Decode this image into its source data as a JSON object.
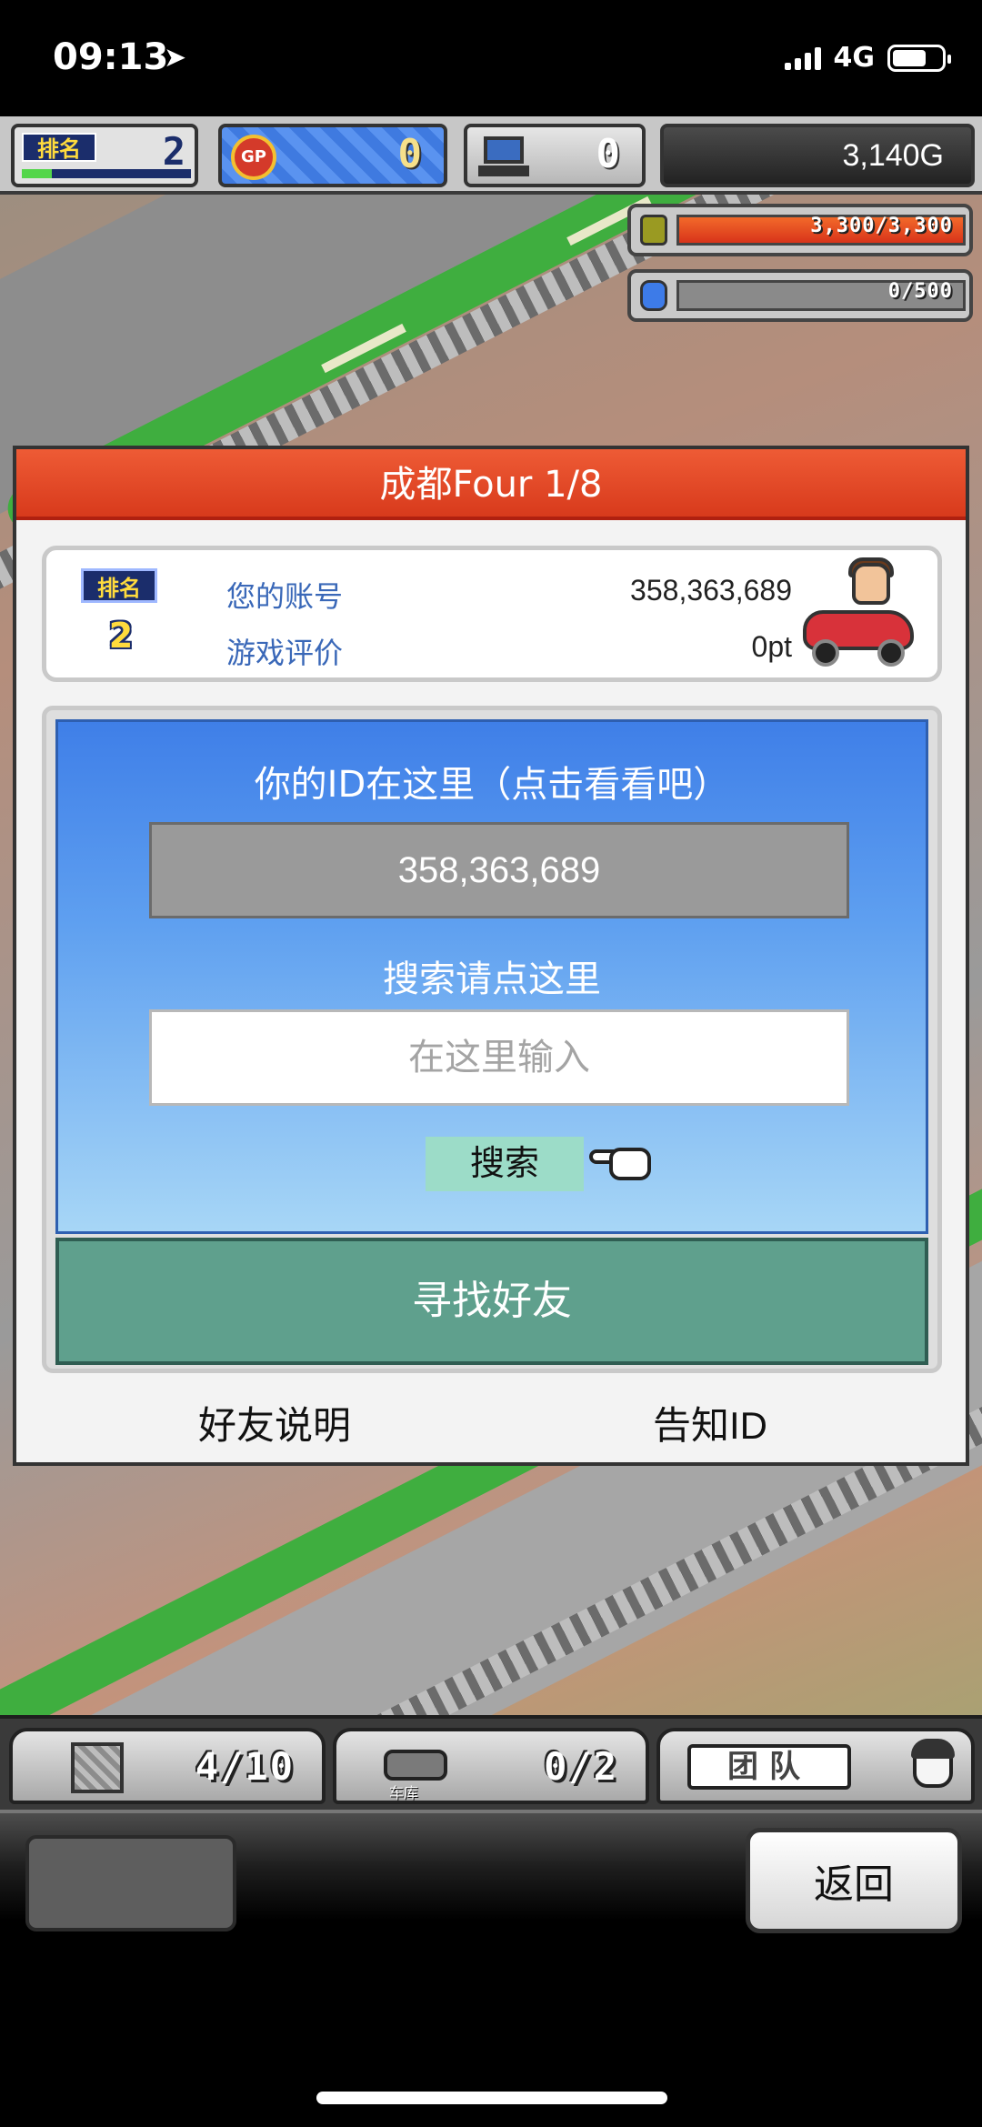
{
  "status": {
    "time": "09:13",
    "network": "4G"
  },
  "hud": {
    "rank_badge": "排名",
    "rank_value": "2",
    "gp_label": "GP",
    "gp_value": "0",
    "pc_value": "0",
    "money": "3,140G"
  },
  "resources": {
    "fuel": {
      "text": "3,300/3,300",
      "fill": 1.0
    },
    "parts": {
      "text": "0/500",
      "fill": 0.0
    }
  },
  "dialog": {
    "title": "成都Four 1/8",
    "profile": {
      "rank_badge": "排名",
      "rank_value": "2",
      "account_label": "您的账号",
      "account_value": "358,363,689",
      "rating_label": "游戏评价",
      "rating_value": "0pt"
    },
    "id_title": "你的ID在这里（点击看看吧）",
    "id_value": "358,363,689",
    "search_title": "搜索请点这里",
    "search_placeholder": "在这里输入",
    "search_button": "搜索",
    "find_friends_button": "寻找好友",
    "friend_help_link": "好友说明",
    "tell_id_link": "告知ID"
  },
  "bottom_hud": {
    "storage_value": "4/10",
    "garage_label": "车库",
    "garage_value": "0/2",
    "team_label": "团队"
  },
  "nav": {
    "back_button": "返回"
  },
  "colors": {
    "header_red": "#e24a28",
    "panel_blue": "#3f7fe8",
    "find_teal": "#5fa08d",
    "search_btn": "#9cdcc8"
  }
}
